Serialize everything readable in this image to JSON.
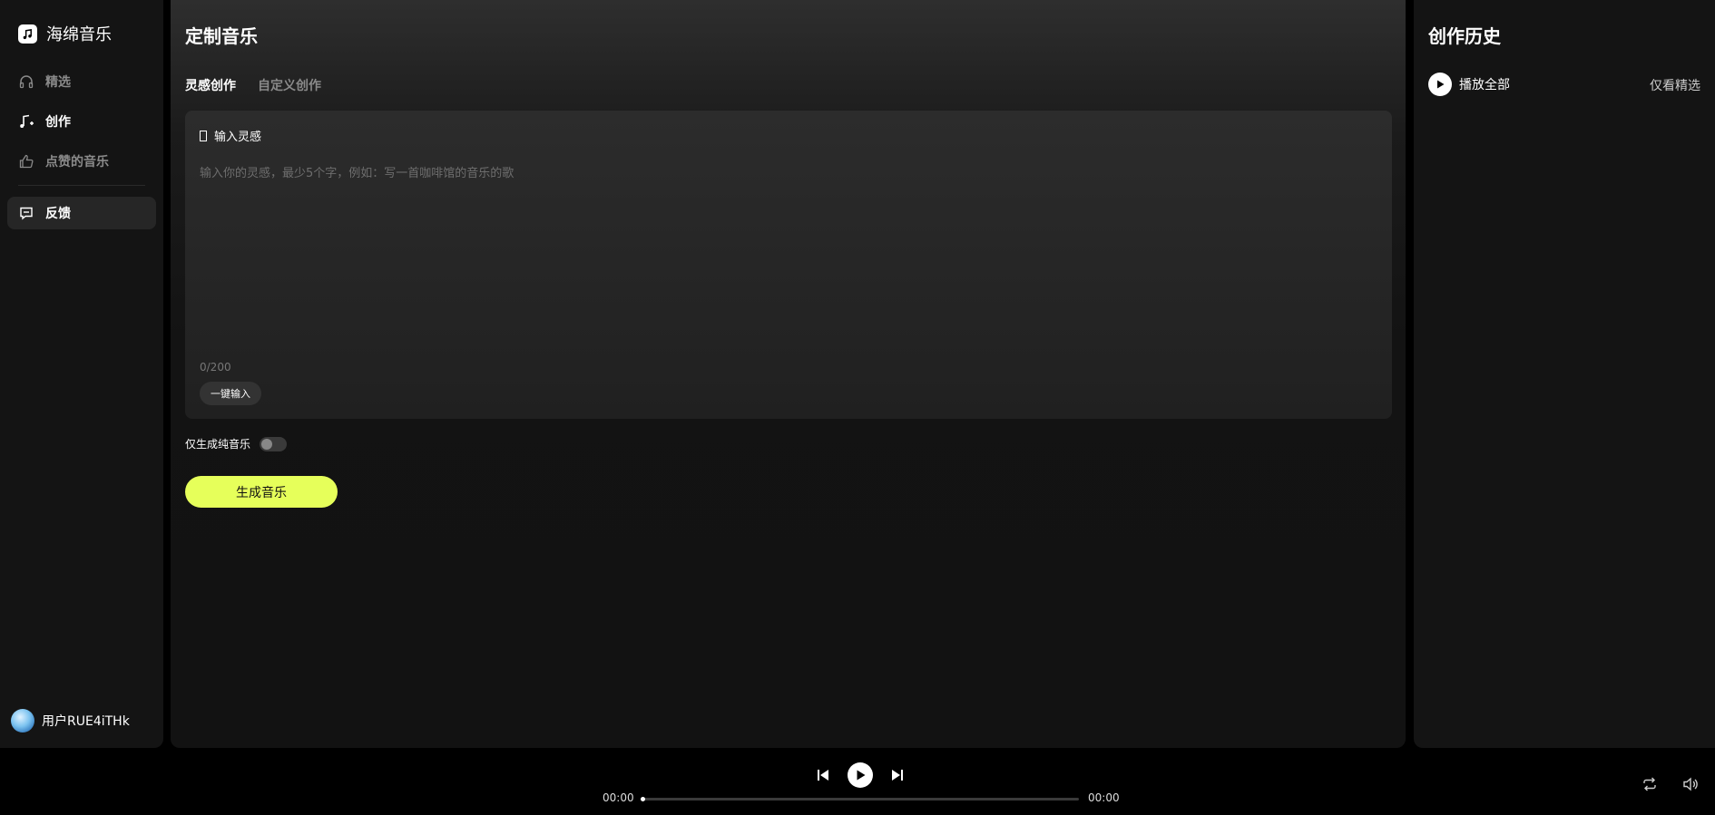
{
  "app": {
    "name": "海绵音乐",
    "icons": {
      "logo": "music-note-icon"
    }
  },
  "sidebar": {
    "items": [
      {
        "label": "精选",
        "icon": "headphones-icon",
        "active": false
      },
      {
        "label": "创作",
        "icon": "music-create-icon",
        "active": true
      },
      {
        "label": "点赞的音乐",
        "icon": "thumbs-up-icon",
        "active": false
      }
    ],
    "feedback": {
      "label": "反馈",
      "icon": "message-icon"
    },
    "user": {
      "name": "用户RUE4iTHk"
    }
  },
  "main": {
    "title": "定制音乐",
    "tabs": [
      {
        "label": "灵感创作",
        "active": true
      },
      {
        "label": "自定义创作",
        "active": false
      }
    ],
    "input": {
      "label": "输入灵感",
      "placeholder": "输入你的灵感，最少5个字，例如：写一首咖啡馆的音乐的歌",
      "value": "",
      "char_count": "0/200",
      "quick_input_label": "一键输入"
    },
    "instrumental_toggle": {
      "label": "仅生成纯音乐",
      "on": false
    },
    "generate_label": "生成音乐"
  },
  "history": {
    "title": "创作历史",
    "play_all_label": "播放全部",
    "only_featured_label": "仅看精选"
  },
  "player": {
    "current_time": "00:00",
    "total_time": "00:00",
    "progress": 0,
    "icons": [
      "prev-icon",
      "play-icon",
      "next-icon",
      "loop-icon",
      "volume-icon"
    ]
  },
  "colors": {
    "accent": "#e6ff5a",
    "background": "#000000",
    "panel": "#141414"
  }
}
